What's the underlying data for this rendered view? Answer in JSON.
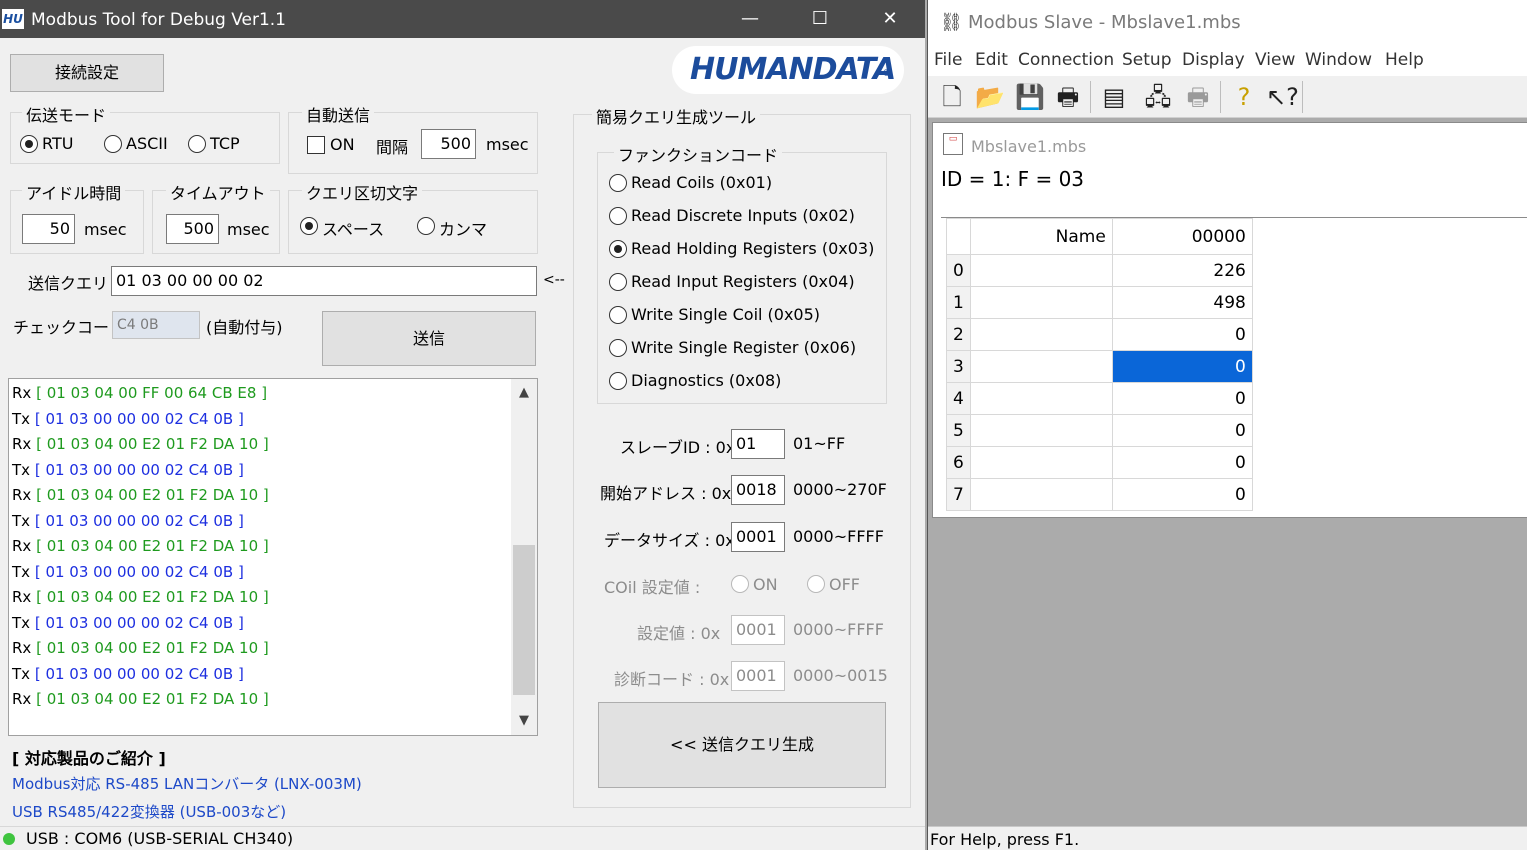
{
  "left": {
    "title": "Modbus Tool for Debug Ver1.1",
    "app_icon": "HU",
    "window_controls": {
      "minimize": "—",
      "maximize": "☐",
      "close": "✕"
    },
    "connect_button": "接続設定",
    "logo": "HUMANDATA",
    "logo_mark": "®",
    "transfer_mode": {
      "label": "伝送モード",
      "options": [
        "RTU",
        "ASCII",
        "TCP"
      ],
      "selected": "RTU"
    },
    "auto_send": {
      "label": "自動送信",
      "on_label": "ON",
      "interval_label": "間隔",
      "interval_value": "500",
      "unit": "msec"
    },
    "idle": {
      "label": "アイドル時間",
      "value": "50",
      "unit": "msec"
    },
    "timeout": {
      "label": "タイムアウト",
      "value": "500",
      "unit": "msec"
    },
    "delimiter": {
      "label": "クエリ区切文字",
      "options": [
        "スペース",
        "カンマ"
      ],
      "selected": "スペース"
    },
    "query": {
      "label": "送信クエリ",
      "value": "01 03 00 00 00 02",
      "arrow": "<--"
    },
    "check": {
      "label": "チェックコード",
      "value": "C4 0B",
      "note": "(自動付与)"
    },
    "send_button": "送信",
    "log": [
      {
        "dir": "Rx",
        "data": "[ 01 03 04 00 FF 00 64 CB E8 ]"
      },
      {
        "dir": "Tx",
        "data": "[ 01 03 00 00 00 02 C4 0B ]"
      },
      {
        "dir": "Rx",
        "data": "[ 01 03 04 00 E2 01 F2 DA 10 ]"
      },
      {
        "dir": "Tx",
        "data": "[ 01 03 00 00 00 02 C4 0B ]"
      },
      {
        "dir": "Rx",
        "data": "[ 01 03 04 00 E2 01 F2 DA 10 ]"
      },
      {
        "dir": "Tx",
        "data": "[ 01 03 00 00 00 02 C4 0B ]"
      },
      {
        "dir": "Rx",
        "data": "[ 01 03 04 00 E2 01 F2 DA 10 ]"
      },
      {
        "dir": "Tx",
        "data": "[ 01 03 00 00 00 02 C4 0B ]"
      },
      {
        "dir": "Rx",
        "data": "[ 01 03 04 00 E2 01 F2 DA 10 ]"
      },
      {
        "dir": "Tx",
        "data": "[ 01 03 00 00 00 02 C4 0B ]"
      },
      {
        "dir": "Rx",
        "data": "[ 01 03 04 00 E2 01 F2 DA 10 ]"
      },
      {
        "dir": "Tx",
        "data": "[ 01 03 00 00 00 02 C4 0B ]"
      },
      {
        "dir": "Rx",
        "data": "[ 01 03 04 00 E2 01 F2 DA 10 ]"
      }
    ],
    "products": {
      "heading": "[ 対応製品のご紹介 ]",
      "links": [
        "Modbus対応 RS-485  LANコンバータ (LNX-003M)",
        "USB RS485/422変換器 (USB-003など)"
      ]
    },
    "qgen": {
      "label": "簡易クエリ生成ツール",
      "func_label": "ファンクションコード",
      "functions": [
        "Read Coils (0x01)",
        "Read Discrete Inputs (0x02)",
        "Read Holding Registers (0x03)",
        "Read Input Registers (0x04)",
        "Write Single Coil (0x05)",
        "Write Single Register (0x06)",
        "Diagnostics (0x08)"
      ],
      "selected_index": 2,
      "slave_id": {
        "label": "スレーブID : 0x",
        "value": "01",
        "range": "01~FF"
      },
      "start_addr": {
        "label": "開始アドレス : 0x",
        "value": "0018",
        "range": "0000~270F"
      },
      "data_size": {
        "label": "データサイズ : 0x",
        "value": "0001",
        "range": "0000~FFFF"
      },
      "coil": {
        "label": "COil 設定値 :",
        "on": "ON",
        "off": "OFF"
      },
      "setting": {
        "label": "設定値 : 0x",
        "value": "0001",
        "range": "0000~FFFF"
      },
      "diag": {
        "label": "診断コード : 0x",
        "value": "0001",
        "range": "0000~0015"
      },
      "gen_button": "<< 送信クエリ生成"
    },
    "status": "USB : COM6 (USB-SERIAL CH340)"
  },
  "right": {
    "title": "Modbus Slave - Mbslave1.mbs",
    "menu": [
      "File",
      "Edit",
      "Connection",
      "Setup",
      "Display",
      "View",
      "Window",
      "Help"
    ],
    "toolbar": [
      "new-icon",
      "open-icon",
      "save-icon",
      "print-icon",
      "window-icon",
      "connect-icon",
      "disconnect-icon",
      "help-icon",
      "context-help-icon"
    ],
    "child_title": "Mbslave1.mbs",
    "id_line": "ID = 1: F = 03",
    "grid": {
      "name_header": "Name",
      "col_header": "00000",
      "rows": [
        {
          "idx": "0",
          "value": "226"
        },
        {
          "idx": "1",
          "value": "498"
        },
        {
          "idx": "2",
          "value": "0"
        },
        {
          "idx": "3",
          "value": "0"
        },
        {
          "idx": "4",
          "value": "0"
        },
        {
          "idx": "5",
          "value": "0"
        },
        {
          "idx": "6",
          "value": "0"
        },
        {
          "idx": "7",
          "value": "0"
        }
      ],
      "selected_row": 3
    },
    "status": "For Help, press F1."
  }
}
